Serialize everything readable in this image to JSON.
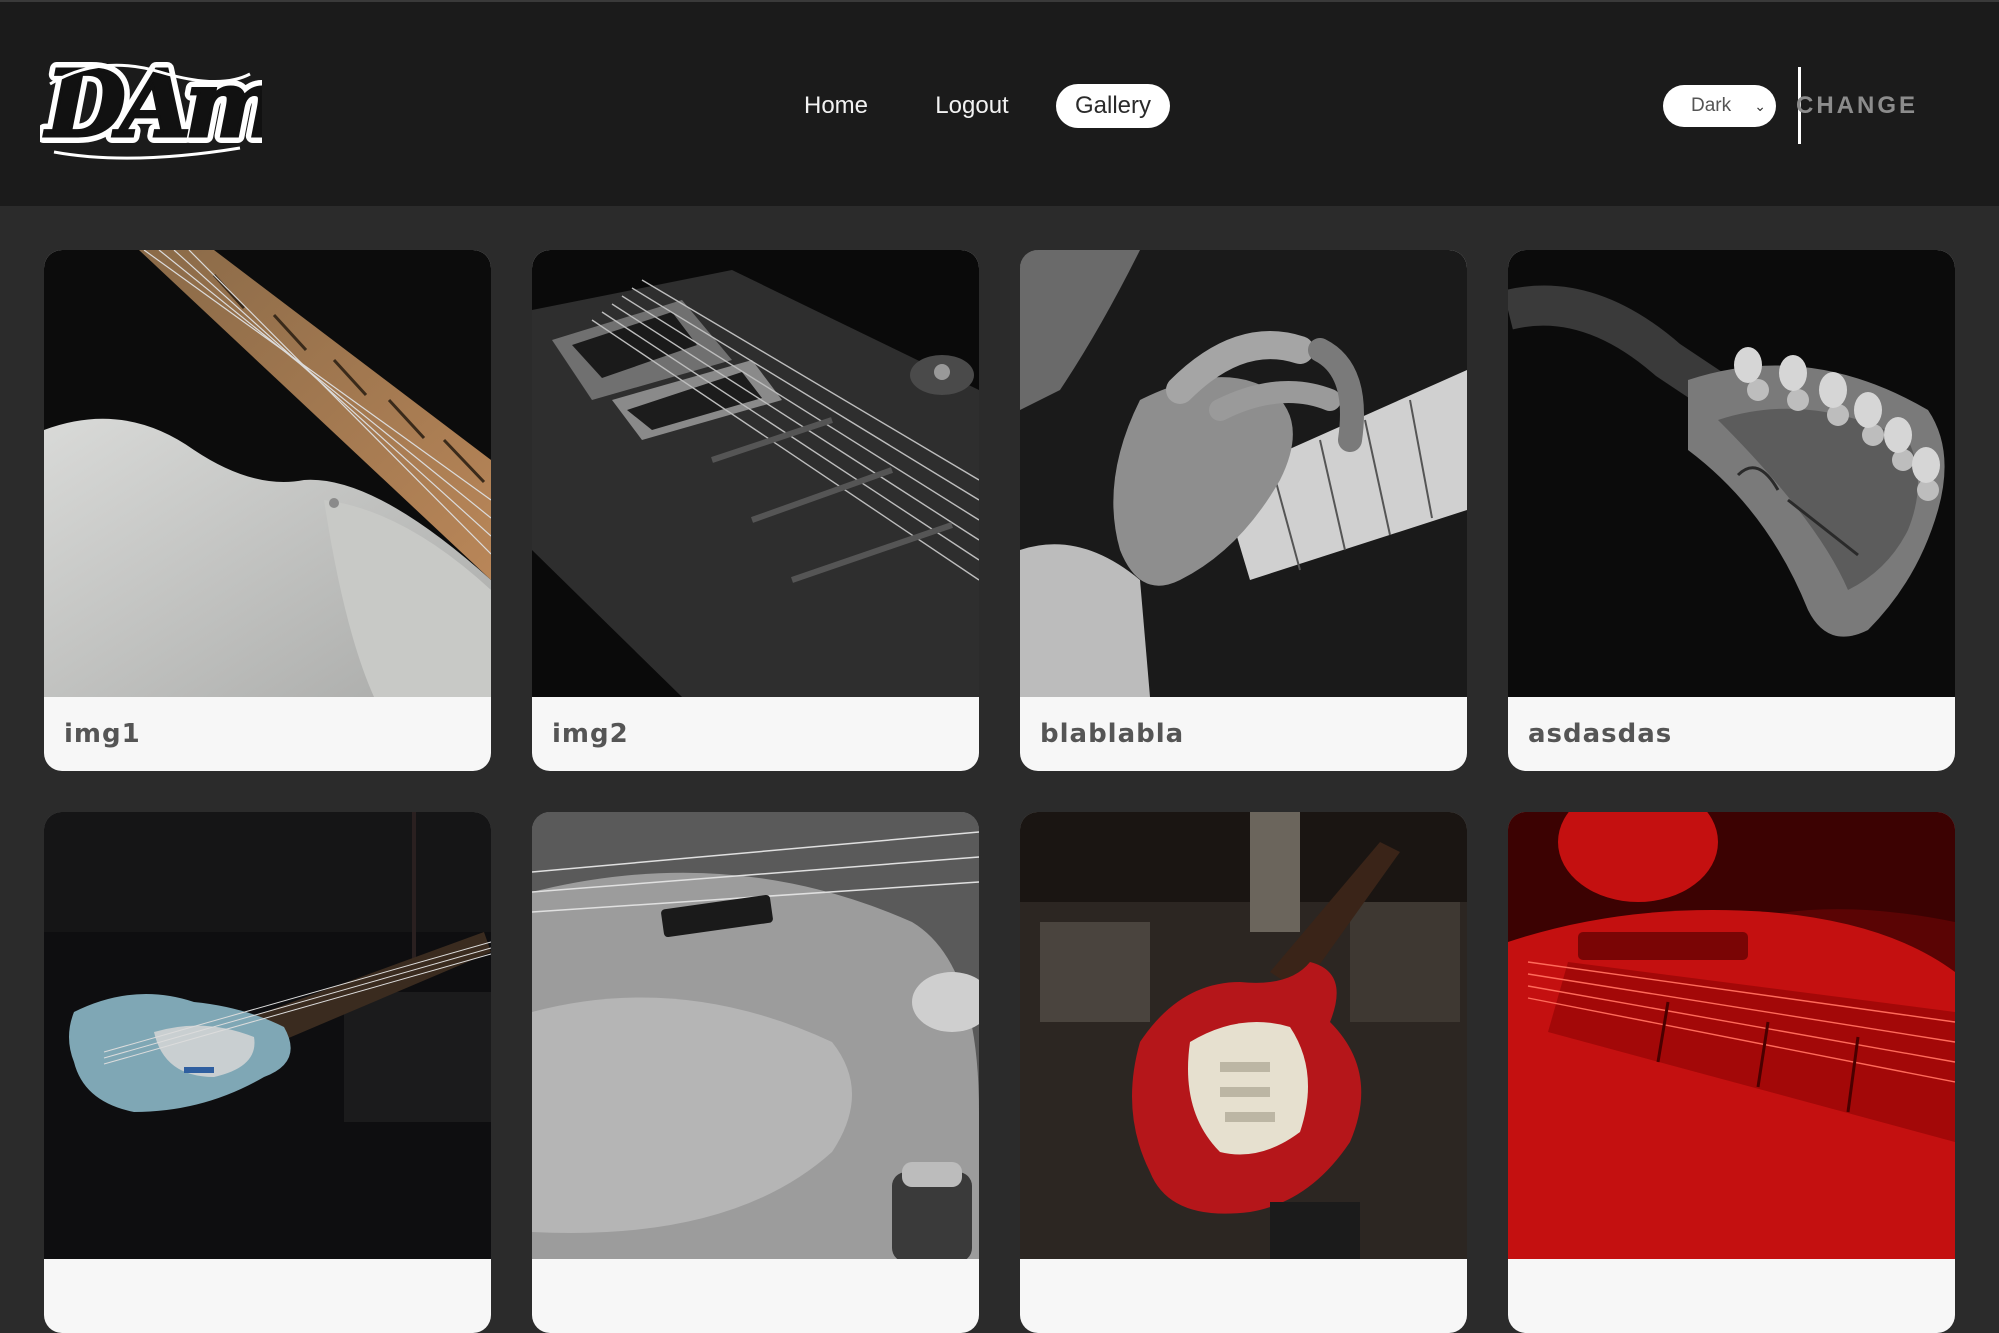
{
  "brand": {
    "logo_text": "DAmiR"
  },
  "nav": {
    "home_label": "Home",
    "logout_label": "Logout",
    "gallery_label": "Gallery",
    "active": "Gallery"
  },
  "theme": {
    "selected": "Dark",
    "change_label": "CHANGE"
  },
  "gallery": {
    "items": [
      {
        "title": "img1",
        "image": "guitar-icon"
      },
      {
        "title": "img2",
        "image": "guitar-icon"
      },
      {
        "title": "blablabla",
        "image": "guitar-icon"
      },
      {
        "title": "asdasdas",
        "image": "guitar-icon"
      },
      {
        "title": "",
        "image": "guitar-icon"
      },
      {
        "title": "",
        "image": "guitar-icon"
      },
      {
        "title": "",
        "image": "guitar-icon"
      },
      {
        "title": "",
        "image": "guitar-icon"
      }
    ]
  },
  "colors": {
    "header_bg": "#1b1b1b",
    "page_bg": "#2b2b2b",
    "card_bg": "#f7f7f7",
    "caption_text": "#555555",
    "accent_red": "#c41010"
  }
}
